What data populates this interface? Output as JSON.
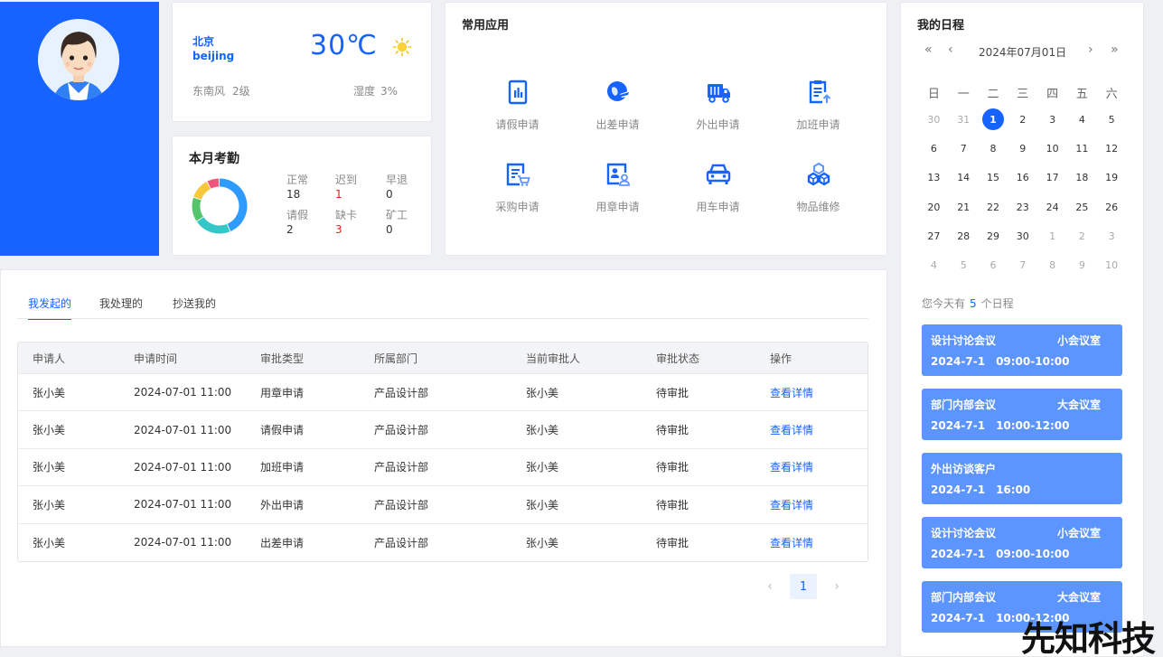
{
  "weather": {
    "city_cn": "北京",
    "city_en": "beijing",
    "temperature": "30℃",
    "wind_direction": "东南风",
    "wind_level": "2级",
    "humidity_label": "湿度",
    "humidity_value": "3%"
  },
  "attendance": {
    "title": "本月考勤",
    "stats": [
      {
        "label": "正常",
        "value": 18,
        "color": "#2f9bff"
      },
      {
        "label": "迟到",
        "value": 1,
        "color": "#e02020"
      },
      {
        "label": "早退",
        "value": 0,
        "color": "#f7c83b"
      },
      {
        "label": "请假",
        "value": 2,
        "color": "#55c46c"
      },
      {
        "label": "缺卡",
        "value": 3,
        "color": "#e02020"
      },
      {
        "label": "矿工",
        "value": 0,
        "color": "#f7c83b"
      }
    ],
    "donut_segments": [
      {
        "value": 18,
        "color": "#2f9bff"
      },
      {
        "value": 9,
        "color": "#35c7c7"
      },
      {
        "value": 6,
        "color": "#55c46c"
      },
      {
        "value": 5,
        "color": "#f7c83b"
      },
      {
        "value": 3,
        "color": "#f2557a"
      }
    ]
  },
  "apps": {
    "title": "常用应用",
    "items": [
      {
        "label": "请假申请",
        "icon": "leave-request-icon"
      },
      {
        "label": "出差申请",
        "icon": "business-trip-icon"
      },
      {
        "label": "外出申请",
        "icon": "outing-truck-icon"
      },
      {
        "label": "加班申请",
        "icon": "overtime-clipboard-icon"
      },
      {
        "label": "采购申请",
        "icon": "purchase-cart-icon"
      },
      {
        "label": "用章申请",
        "icon": "seal-user-icon"
      },
      {
        "label": "用车申请",
        "icon": "car-icon"
      },
      {
        "label": "物品维修",
        "icon": "repair-boxes-icon"
      }
    ]
  },
  "schedule": {
    "title": "我的日程",
    "nav": {
      "prev_year": "«",
      "prev_month": "‹",
      "next_month": "›",
      "next_year": "»"
    },
    "year_month": "2024年07月01日",
    "weekdays": [
      "日",
      "一",
      "二",
      "三",
      "四",
      "五",
      "六"
    ],
    "days": [
      {
        "d": "30",
        "m": true
      },
      {
        "d": "31",
        "m": true
      },
      {
        "d": "1",
        "sel": true
      },
      {
        "d": "2"
      },
      {
        "d": "3"
      },
      {
        "d": "4"
      },
      {
        "d": "5"
      },
      {
        "d": "6"
      },
      {
        "d": "7"
      },
      {
        "d": "8"
      },
      {
        "d": "9"
      },
      {
        "d": "10"
      },
      {
        "d": "11"
      },
      {
        "d": "12"
      },
      {
        "d": "13"
      },
      {
        "d": "14"
      },
      {
        "d": "15"
      },
      {
        "d": "16"
      },
      {
        "d": "17"
      },
      {
        "d": "18"
      },
      {
        "d": "19"
      },
      {
        "d": "20"
      },
      {
        "d": "21"
      },
      {
        "d": "22"
      },
      {
        "d": "23"
      },
      {
        "d": "24"
      },
      {
        "d": "25"
      },
      {
        "d": "26"
      },
      {
        "d": "27"
      },
      {
        "d": "28"
      },
      {
        "d": "29"
      },
      {
        "d": "30"
      },
      {
        "d": "1",
        "m": true
      },
      {
        "d": "2",
        "m": true
      },
      {
        "d": "3",
        "m": true
      },
      {
        "d": "4",
        "m": true
      },
      {
        "d": "5",
        "m": true
      },
      {
        "d": "6",
        "m": true
      },
      {
        "d": "7",
        "m": true
      },
      {
        "d": "8",
        "m": true
      },
      {
        "d": "9",
        "m": true
      },
      {
        "d": "10",
        "m": true
      }
    ],
    "summary_prefix": "您今天有",
    "summary_count": "5",
    "summary_suffix": "个日程",
    "items": [
      {
        "title": "设计讨论会议",
        "room": "小会议室",
        "date": "2024-7-1",
        "time": "09:00-10:00"
      },
      {
        "title": "部门内部会议",
        "room": "大会议室",
        "date": "2024-7-1",
        "time": "10:00-12:00"
      },
      {
        "title": "外出访谈客户",
        "room": "",
        "date": "2024-7-1",
        "time": "16:00"
      },
      {
        "title": "设计讨论会议",
        "room": "小会议室",
        "date": "2024-7-1",
        "time": "09:00-10:00"
      },
      {
        "title": "部门内部会议",
        "room": "大会议室",
        "date": "2024-7-1",
        "time": "10:00-12:00"
      }
    ]
  },
  "approvals": {
    "tabs": [
      "我发起的",
      "我处理的",
      "抄送我的"
    ],
    "columns": [
      "申请人",
      "申请时间",
      "审批类型",
      "所属部门",
      "当前审批人",
      "审批状态",
      "操作"
    ],
    "rows": [
      [
        "张小美",
        "2024-07-01 11:00",
        "用章申请",
        "产品设计部",
        "张小美",
        "待审批",
        "查看详情"
      ],
      [
        "张小美",
        "2024-07-01 11:00",
        "请假申请",
        "产品设计部",
        "张小美",
        "待审批",
        "查看详情"
      ],
      [
        "张小美",
        "2024-07-01 11:00",
        "加班申请",
        "产品设计部",
        "张小美",
        "待审批",
        "查看详情"
      ],
      [
        "张小美",
        "2024-07-01 11:00",
        "外出申请",
        "产品设计部",
        "张小美",
        "待审批",
        "查看详情"
      ],
      [
        "张小美",
        "2024-07-01 11:00",
        "出差申请",
        "产品设计部",
        "张小美",
        "待审批",
        "查看详情"
      ]
    ],
    "pager": {
      "prev": "‹",
      "page": "1",
      "next": "›"
    }
  },
  "watermark": "先知科技",
  "colors": {
    "primary": "#1663ff",
    "schedule_item": "#5c95ff",
    "danger": "#e02020"
  }
}
